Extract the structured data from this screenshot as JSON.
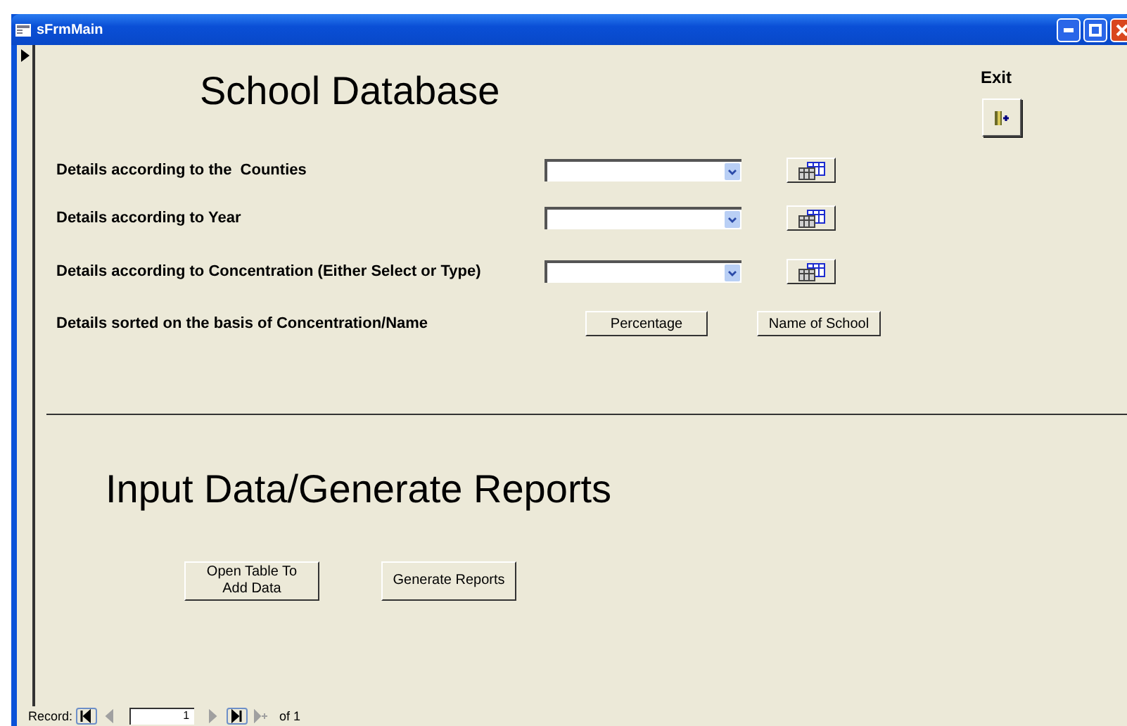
{
  "window": {
    "title": "sFrmMain"
  },
  "record_selector": {
    "current": true
  },
  "heading": "School Database",
  "exit": {
    "label": "Exit"
  },
  "filters": [
    {
      "label": "Details according to the  Counties",
      "kind": "combo"
    },
    {
      "label": "Details according to Year",
      "kind": "combo"
    },
    {
      "label": "Details according to Concentration (Either Select or Type)",
      "kind": "combo"
    }
  ],
  "sort": {
    "label": "Details sorted on the basis of Concentration/Name",
    "buttons": [
      "Percentage",
      "Name of School"
    ]
  },
  "section_heading": "Input Data/Generate Reports",
  "actions": [
    "Open Table To Add Data",
    "Generate Reports"
  ],
  "navigator": {
    "label": "Record:",
    "current": "1",
    "total": "of 1",
    "buttons": [
      {
        "kind": "first",
        "disabled": false
      },
      {
        "kind": "prev",
        "disabled": true
      },
      {
        "kind": "next",
        "disabled": true
      },
      {
        "kind": "last",
        "disabled": false
      },
      {
        "kind": "new",
        "disabled": true
      }
    ]
  }
}
